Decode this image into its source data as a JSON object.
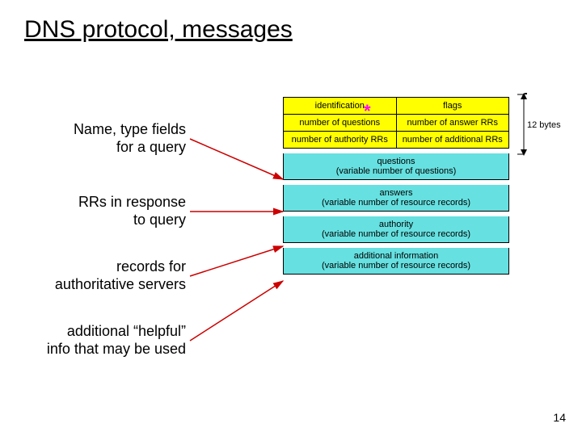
{
  "title": "DNS protocol, messages",
  "labels": {
    "l1a": "Name, type fields",
    "l1b": "for a query",
    "l2a": "RRs in response",
    "l2b": "to query",
    "l3a": "records for",
    "l3b": "authoritative servers",
    "l4a": "additional “helpful”",
    "l4b": "info that may be used"
  },
  "header": {
    "r1c1": "identification",
    "r1c2": "flags",
    "r2c1": "number of questions",
    "r2c2": "number of answer RRs",
    "r3c1": "number of authority RRs",
    "r3c2": "number of additional RRs"
  },
  "body": {
    "b1a": "questions",
    "b1b": "(variable number of questions)",
    "b2a": "answers",
    "b2b": "(variable number of resource records)",
    "b3a": "authority",
    "b3b": "(variable number of resource records)",
    "b4a": "additional information",
    "b4b": "(variable number of resource records)"
  },
  "bracket_label": "12 bytes",
  "star": "*",
  "page_number": "14"
}
